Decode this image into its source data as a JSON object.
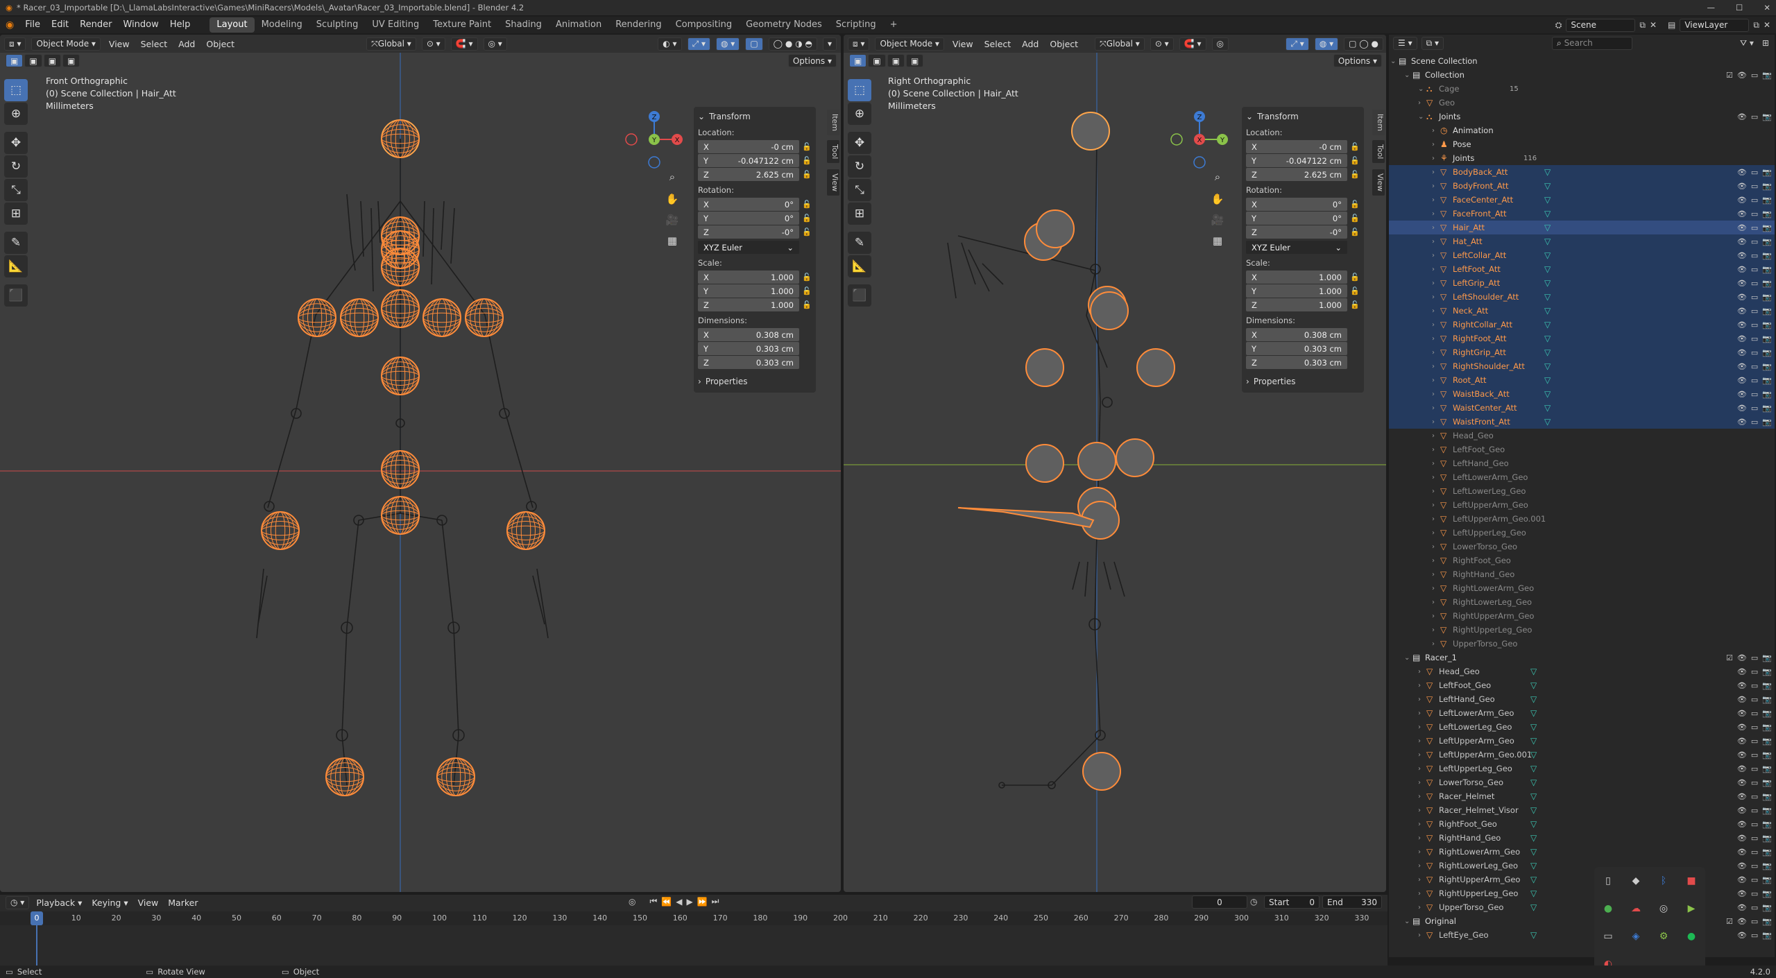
{
  "window": {
    "title": "* Racer_03_Importable [D:\\_LlamaLabsInteractive\\Games\\MiniRacers\\Models\\_Avatar\\Racer_03_Importable.blend] - Blender 4.2"
  },
  "menus": [
    "File",
    "Edit",
    "Render",
    "Window",
    "Help"
  ],
  "workspaces": [
    "Layout",
    "Modeling",
    "Sculpting",
    "UV Editing",
    "Texture Paint",
    "Shading",
    "Animation",
    "Rendering",
    "Compositing",
    "Geometry Nodes",
    "Scripting"
  ],
  "active_workspace": "Layout",
  "scene": {
    "name": "Scene",
    "view_layer": "ViewLayer"
  },
  "viewport_menus": [
    "View",
    "Select",
    "Add",
    "Object"
  ],
  "mode": "Object Mode",
  "orientation": "Global",
  "options_label": "Options",
  "left_viewport": {
    "view": "Front Orthographic",
    "collection": "(0) Scene Collection | Hair_Att",
    "units": "Millimeters"
  },
  "right_viewport": {
    "view": "Right Orthographic",
    "collection": "(0) Scene Collection | Hair_Att",
    "units": "Millimeters"
  },
  "transform": {
    "header": "Transform",
    "location_label": "Location:",
    "location": [
      {
        "axis": "X",
        "value": "-0 cm"
      },
      {
        "axis": "Y",
        "value": "-0.047122 cm"
      },
      {
        "axis": "Z",
        "value": "2.625 cm"
      }
    ],
    "rotation_label": "Rotation:",
    "rotation": [
      {
        "axis": "X",
        "value": "0°"
      },
      {
        "axis": "Y",
        "value": "0°"
      },
      {
        "axis": "Z",
        "value": "-0°"
      }
    ],
    "rotation_mode": "XYZ Euler",
    "scale_label": "Scale:",
    "scale": [
      {
        "axis": "X",
        "value": "1.000"
      },
      {
        "axis": "Y",
        "value": "1.000"
      },
      {
        "axis": "Z",
        "value": "1.000"
      }
    ],
    "dimensions_label": "Dimensions:",
    "dimensions": [
      {
        "axis": "X",
        "value": "0.308 cm"
      },
      {
        "axis": "Y",
        "value": "0.303 cm"
      },
      {
        "axis": "Z",
        "value": "0.303 cm"
      }
    ],
    "properties": "Properties"
  },
  "sidebar_tabs": [
    "Item",
    "Tool",
    "View"
  ],
  "outliner": {
    "search_placeholder": "Search",
    "rows": [
      {
        "label": "Scene Collection",
        "indent": 0,
        "icon": "collection",
        "sel": false
      },
      {
        "label": "Collection",
        "indent": 1,
        "icon": "collection",
        "sel": false,
        "vis": true
      },
      {
        "label": "Cage",
        "indent": 2,
        "icon": "armature",
        "sel": false,
        "dim": true,
        "extra": "15"
      },
      {
        "label": "Geo",
        "indent": 2,
        "icon": "mesh",
        "sel": false,
        "dim": true
      },
      {
        "label": "Joints",
        "indent": 2,
        "icon": "armature",
        "sel": false,
        "vis": true
      },
      {
        "label": "Animation",
        "indent": 3,
        "icon": "anim",
        "sel": false
      },
      {
        "label": "Pose",
        "indent": 3,
        "icon": "pose",
        "sel": false
      },
      {
        "label": "Joints",
        "indent": 3,
        "icon": "bone",
        "sel": false,
        "extra": "116"
      },
      {
        "label": "BodyBack_Att",
        "indent": 3,
        "icon": "mesh",
        "sel": true,
        "vis": true
      },
      {
        "label": "BodyFront_Att",
        "indent": 3,
        "icon": "mesh",
        "sel": true,
        "vis": true
      },
      {
        "label": "FaceCenter_Att",
        "indent": 3,
        "icon": "mesh",
        "sel": true,
        "vis": true
      },
      {
        "label": "FaceFront_Att",
        "indent": 3,
        "icon": "mesh",
        "sel": true,
        "vis": true
      },
      {
        "label": "Hair_Att",
        "indent": 3,
        "icon": "mesh",
        "sel": true,
        "active": true,
        "vis": true
      },
      {
        "label": "Hat_Att",
        "indent": 3,
        "icon": "mesh",
        "sel": true,
        "vis": true
      },
      {
        "label": "LeftCollar_Att",
        "indent": 3,
        "icon": "mesh",
        "sel": true,
        "vis": true
      },
      {
        "label": "LeftFoot_Att",
        "indent": 3,
        "icon": "mesh",
        "sel": true,
        "vis": true
      },
      {
        "label": "LeftGrip_Att",
        "indent": 3,
        "icon": "mesh",
        "sel": true,
        "vis": true
      },
      {
        "label": "LeftShoulder_Att",
        "indent": 3,
        "icon": "mesh",
        "sel": true,
        "vis": true
      },
      {
        "label": "Neck_Att",
        "indent": 3,
        "icon": "mesh",
        "sel": true,
        "vis": true
      },
      {
        "label": "RightCollar_Att",
        "indent": 3,
        "icon": "mesh",
        "sel": true,
        "vis": true
      },
      {
        "label": "RightFoot_Att",
        "indent": 3,
        "icon": "mesh",
        "sel": true,
        "vis": true
      },
      {
        "label": "RightGrip_Att",
        "indent": 3,
        "icon": "mesh",
        "sel": true,
        "vis": true
      },
      {
        "label": "RightShoulder_Att",
        "indent": 3,
        "icon": "mesh",
        "sel": true,
        "vis": true
      },
      {
        "label": "Root_Att",
        "indent": 3,
        "icon": "mesh",
        "sel": true,
        "vis": true
      },
      {
        "label": "WaistBack_Att",
        "indent": 3,
        "icon": "mesh",
        "sel": true,
        "vis": true
      },
      {
        "label": "WaistCenter_Att",
        "indent": 3,
        "icon": "mesh",
        "sel": true,
        "vis": true
      },
      {
        "label": "WaistFront_Att",
        "indent": 3,
        "icon": "mesh",
        "sel": true,
        "vis": true
      },
      {
        "label": "Head_Geo",
        "indent": 3,
        "icon": "mesh",
        "sel": false,
        "dim": true
      },
      {
        "label": "LeftFoot_Geo",
        "indent": 3,
        "icon": "mesh",
        "sel": false,
        "dim": true
      },
      {
        "label": "LeftHand_Geo",
        "indent": 3,
        "icon": "mesh",
        "sel": false,
        "dim": true
      },
      {
        "label": "LeftLowerArm_Geo",
        "indent": 3,
        "icon": "mesh",
        "sel": false,
        "dim": true
      },
      {
        "label": "LeftLowerLeg_Geo",
        "indent": 3,
        "icon": "mesh",
        "sel": false,
        "dim": true
      },
      {
        "label": "LeftUpperArm_Geo",
        "indent": 3,
        "icon": "mesh",
        "sel": false,
        "dim": true
      },
      {
        "label": "LeftUpperArm_Geo.001",
        "indent": 3,
        "icon": "mesh",
        "sel": false,
        "dim": true
      },
      {
        "label": "LeftUpperLeg_Geo",
        "indent": 3,
        "icon": "mesh",
        "sel": false,
        "dim": true
      },
      {
        "label": "LowerTorso_Geo",
        "indent": 3,
        "icon": "mesh",
        "sel": false,
        "dim": true
      },
      {
        "label": "RightFoot_Geo",
        "indent": 3,
        "icon": "mesh",
        "sel": false,
        "dim": true
      },
      {
        "label": "RightHand_Geo",
        "indent": 3,
        "icon": "mesh",
        "sel": false,
        "dim": true
      },
      {
        "label": "RightLowerArm_Geo",
        "indent": 3,
        "icon": "mesh",
        "sel": false,
        "dim": true
      },
      {
        "label": "RightLowerLeg_Geo",
        "indent": 3,
        "icon": "mesh",
        "sel": false,
        "dim": true
      },
      {
        "label": "RightUpperArm_Geo",
        "indent": 3,
        "icon": "mesh",
        "sel": false,
        "dim": true
      },
      {
        "label": "RightUpperLeg_Geo",
        "indent": 3,
        "icon": "mesh",
        "sel": false,
        "dim": true
      },
      {
        "label": "UpperTorso_Geo",
        "indent": 3,
        "icon": "mesh",
        "sel": false,
        "dim": true
      },
      {
        "label": "Racer_1",
        "indent": 1,
        "icon": "collection",
        "sel": false,
        "vis": true
      },
      {
        "label": "Head_Geo",
        "indent": 2,
        "icon": "mesh",
        "sel": false,
        "vis": true
      },
      {
        "label": "LeftFoot_Geo",
        "indent": 2,
        "icon": "mesh",
        "sel": false,
        "vis": true
      },
      {
        "label": "LeftHand_Geo",
        "indent": 2,
        "icon": "mesh",
        "sel": false,
        "vis": true
      },
      {
        "label": "LeftLowerArm_Geo",
        "indent": 2,
        "icon": "mesh",
        "sel": false,
        "vis": true
      },
      {
        "label": "LeftLowerLeg_Geo",
        "indent": 2,
        "icon": "mesh",
        "sel": false,
        "vis": true
      },
      {
        "label": "LeftUpperArm_Geo",
        "indent": 2,
        "icon": "mesh",
        "sel": false,
        "vis": true
      },
      {
        "label": "LeftUpperArm_Geo.001",
        "indent": 2,
        "icon": "mesh",
        "sel": false,
        "vis": true
      },
      {
        "label": "LeftUpperLeg_Geo",
        "indent": 2,
        "icon": "mesh",
        "sel": false,
        "vis": true
      },
      {
        "label": "LowerTorso_Geo",
        "indent": 2,
        "icon": "mesh",
        "sel": false,
        "vis": true
      },
      {
        "label": "Racer_Helmet",
        "indent": 2,
        "icon": "mesh",
        "sel": false,
        "vis": true
      },
      {
        "label": "Racer_Helmet_Visor",
        "indent": 2,
        "icon": "mesh",
        "sel": false,
        "vis": true
      },
      {
        "label": "RightFoot_Geo",
        "indent": 2,
        "icon": "mesh",
        "sel": false,
        "vis": true
      },
      {
        "label": "RightHand_Geo",
        "indent": 2,
        "icon": "mesh",
        "sel": false,
        "vis": true
      },
      {
        "label": "RightLowerArm_Geo",
        "indent": 2,
        "icon": "mesh",
        "sel": false,
        "vis": true
      },
      {
        "label": "RightLowerLeg_Geo",
        "indent": 2,
        "icon": "mesh",
        "sel": false,
        "vis": true
      },
      {
        "label": "RightUpperArm_Geo",
        "indent": 2,
        "icon": "mesh",
        "sel": false,
        "vis": true
      },
      {
        "label": "RightUpperLeg_Geo",
        "indent": 2,
        "icon": "mesh",
        "sel": false,
        "vis": true
      },
      {
        "label": "UpperTorso_Geo",
        "indent": 2,
        "icon": "mesh",
        "sel": false,
        "vis": true
      },
      {
        "label": "Original",
        "indent": 1,
        "icon": "collection",
        "sel": false,
        "vis": true
      },
      {
        "label": "LeftEye_Geo",
        "indent": 2,
        "icon": "mesh",
        "sel": false,
        "vis": true
      }
    ]
  },
  "timeline": {
    "menus": [
      "Playback",
      "Keying",
      "View",
      "Marker"
    ],
    "current_frame": "0",
    "start_label": "Start",
    "start": "0",
    "end_label": "End",
    "end": "330",
    "ticks": [
      "0",
      "10",
      "20",
      "30",
      "40",
      "50",
      "60",
      "70",
      "80",
      "90",
      "100",
      "110",
      "120",
      "130",
      "140",
      "150",
      "160",
      "170",
      "180",
      "190",
      "200",
      "210",
      "220",
      "230",
      "240",
      "250",
      "260",
      "270",
      "280",
      "290",
      "300",
      "310",
      "320",
      "330"
    ]
  },
  "statusbar": {
    "select": "Select",
    "rotate": "Rotate View",
    "object": "Object",
    "version": "4.2.0"
  },
  "colors": {
    "accent": "#4772b3",
    "selected_orange": "#ff8c3a",
    "active_orange": "#ffa54a",
    "x_axis": "#e24b4b",
    "y_axis": "#8bc34a",
    "z_axis": "#3d7bd4"
  }
}
